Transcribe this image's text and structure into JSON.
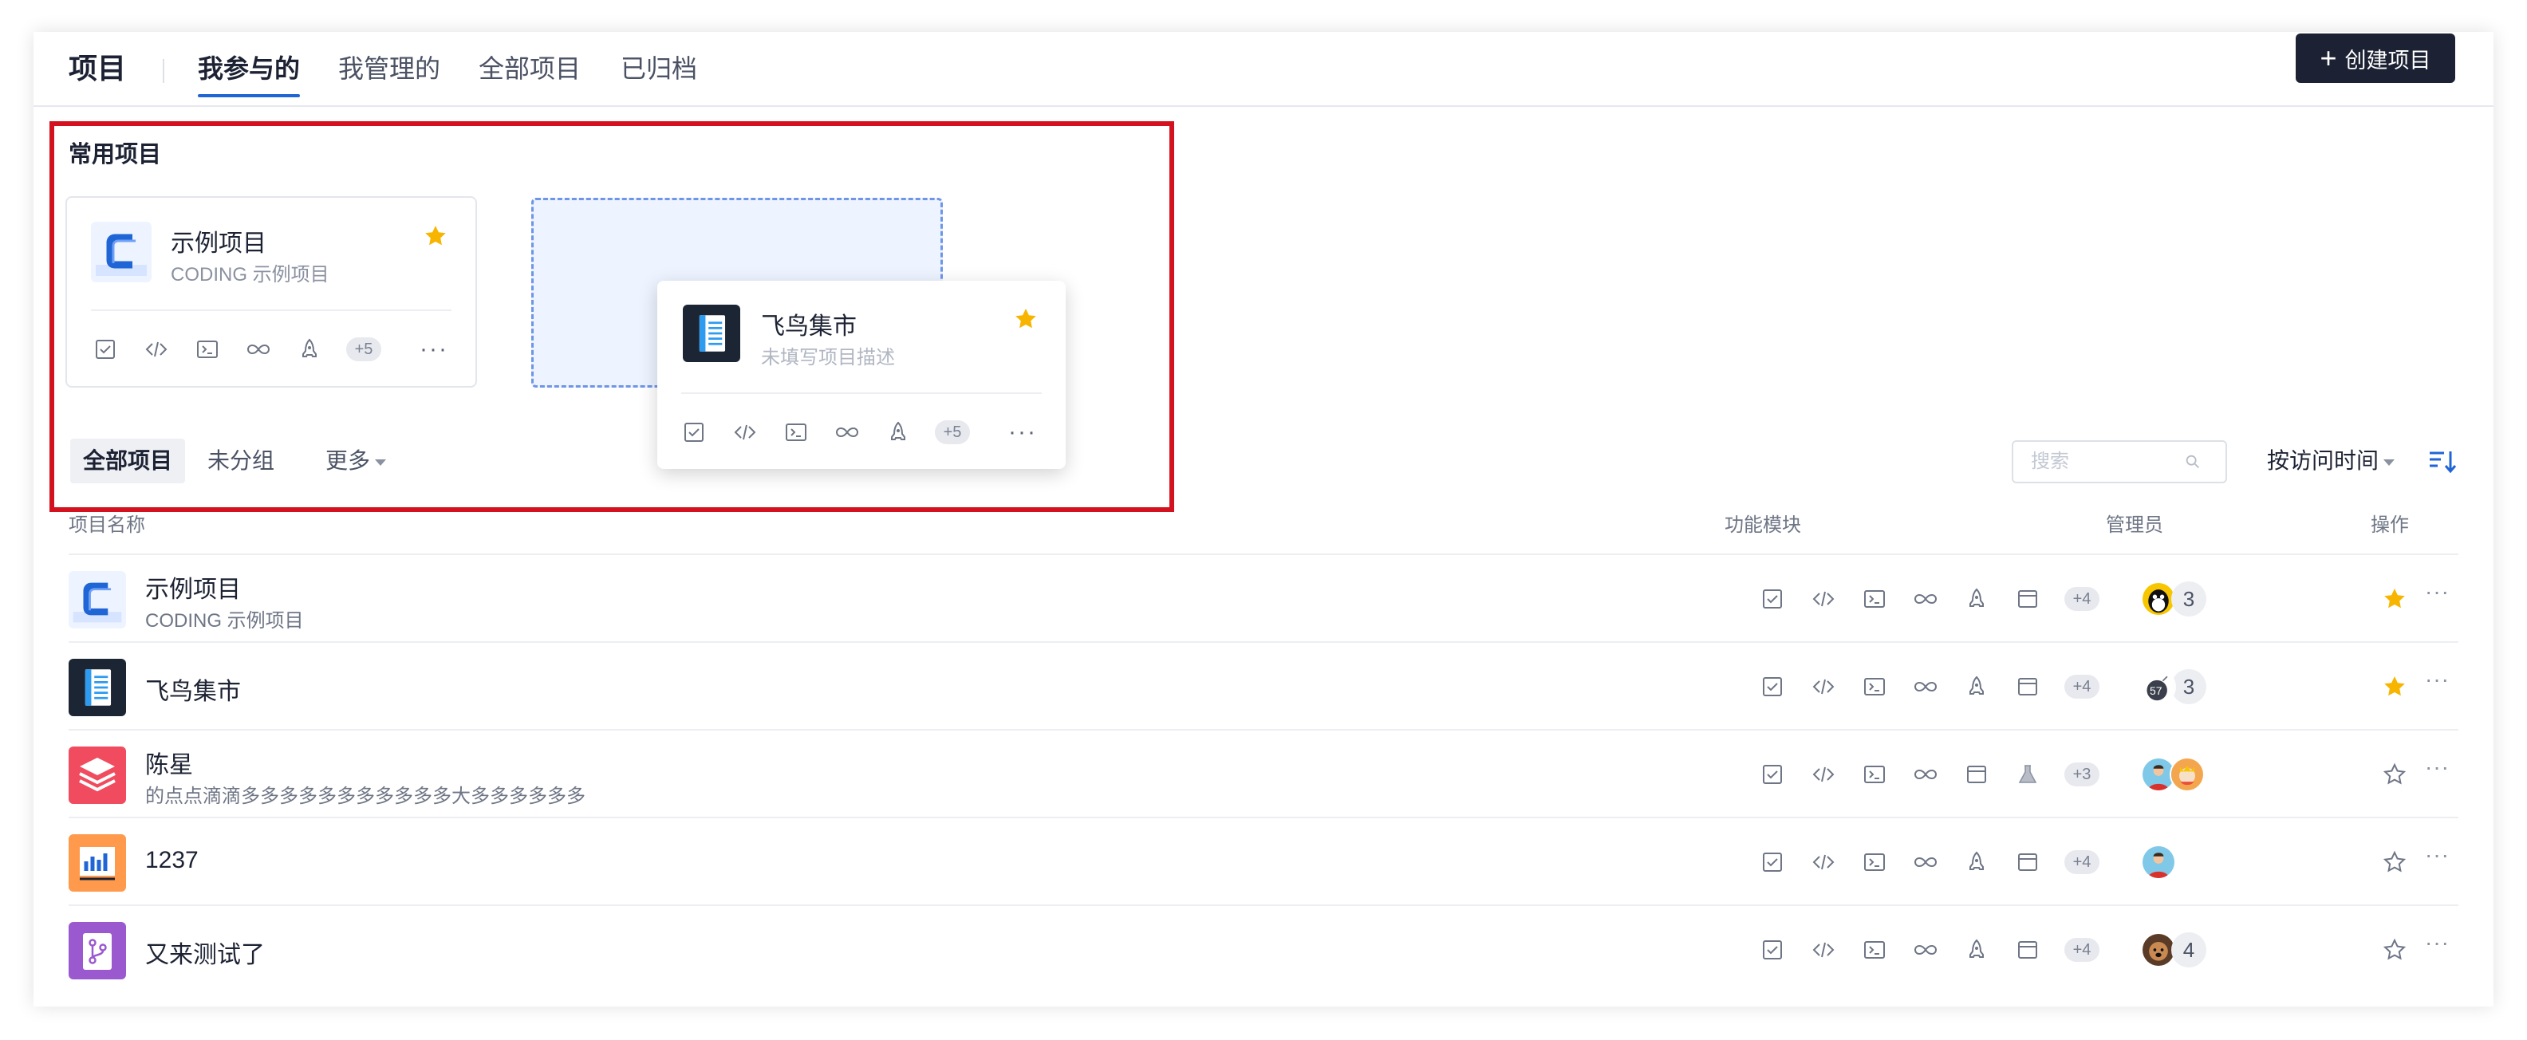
{
  "header": {
    "title": "项目",
    "tabs": [
      "我参与的",
      "我管理的",
      "全部项目",
      "已归档"
    ],
    "create_button": "创建项目"
  },
  "favorites": {
    "title": "常用项目",
    "cards": [
      {
        "name": "示例项目",
        "desc": "CODING 示例项目",
        "extra": "+5",
        "starred": true
      },
      {
        "name": "飞鸟集市",
        "desc": "未填写项目描述",
        "extra": "+5",
        "starred": true
      }
    ]
  },
  "filters": {
    "all": "全部项目",
    "ungrouped": "未分组",
    "more": "更多"
  },
  "search": {
    "placeholder": "搜索"
  },
  "sort": {
    "label": "按访问时间"
  },
  "table": {
    "columns": {
      "name": "项目名称",
      "modules": "功能模块",
      "admins": "管理员",
      "actions": "操作"
    },
    "rows": [
      {
        "name": "示例项目",
        "desc": "CODING 示例项目",
        "extra": "+4",
        "admin_count": "3",
        "starred": true
      },
      {
        "name": "飞鸟集市",
        "desc": "",
        "extra": "+4",
        "admin_count": "3",
        "avatar_badge": "57",
        "starred": true
      },
      {
        "name": "陈星",
        "desc": "的点点滴滴多多多多多多多多多多多大多多多多多多",
        "extra": "+3",
        "admin_count": "",
        "starred": false
      },
      {
        "name": "1237",
        "desc": "",
        "extra": "+4",
        "admin_count": "",
        "starred": false
      },
      {
        "name": "又来测试了",
        "desc": "",
        "extra": "+4",
        "admin_count": "4",
        "starred": false
      }
    ]
  },
  "colors": {
    "accent": "#1f65d6",
    "dark": "#1c2233",
    "star": "#f7b500",
    "highlight": "#d4111e"
  }
}
